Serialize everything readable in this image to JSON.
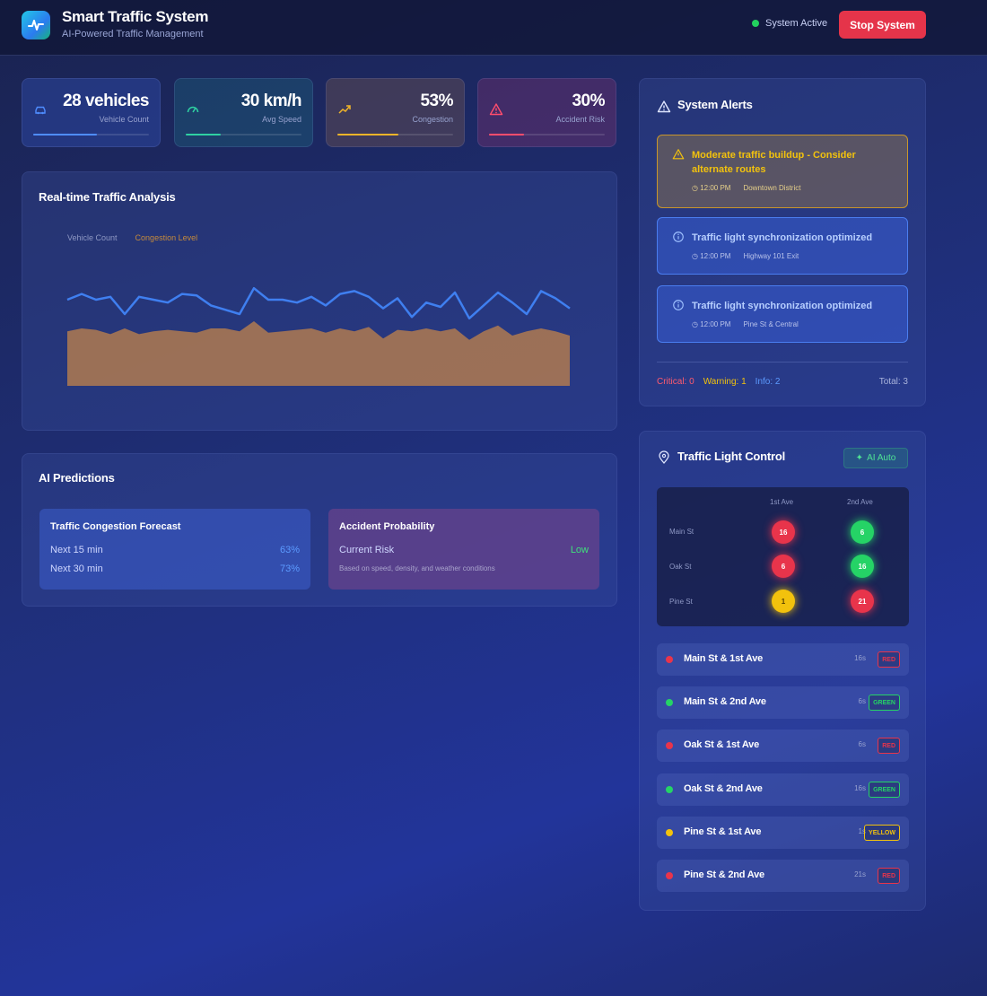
{
  "header": {
    "title": "Smart Traffic System",
    "subtitle": "AI-Powered Traffic Management",
    "status_text": "System Active",
    "stop_label": "Stop System"
  },
  "stats": [
    {
      "value": "28 vehicles",
      "label": "Vehicle Count",
      "icon": "car-icon",
      "color": "#4f8dff",
      "level": 0.55
    },
    {
      "value": "30 km/h",
      "label": "Avg Speed",
      "icon": "gauge-icon",
      "color": "#2fd1a2",
      "level": 0.3
    },
    {
      "value": "53%",
      "label": "Congestion",
      "icon": "trend-up-icon",
      "color": "#f0b429",
      "level": 0.53
    },
    {
      "value": "30%",
      "label": "Accident Risk",
      "icon": "warning-icon",
      "color": "#ff4d6d",
      "level": 0.3
    }
  ],
  "chart": {
    "title": "Real-time Traffic Analysis",
    "legend": [
      "Vehicle Count",
      "Congestion Level"
    ],
    "colors": {
      "vehicle": "#3f7ff0",
      "congestion": "#b07a50"
    }
  },
  "chart_data": {
    "type": "area",
    "title": "Real-time Traffic Analysis",
    "xlabel": "",
    "ylabel": "",
    "ylim": [
      0,
      100
    ],
    "grid": false,
    "legend": "top-left",
    "series": [
      {
        "name": "Vehicle Count",
        "type": "line",
        "values": [
          60,
          64,
          60,
          62,
          50,
          62,
          60,
          58,
          64,
          63,
          56,
          53,
          50,
          68,
          60,
          60,
          58,
          62,
          56,
          64,
          66,
          62,
          54,
          61,
          48,
          58,
          55,
          65,
          47,
          56,
          65,
          58,
          50,
          66,
          61,
          54
        ]
      },
      {
        "name": "Congestion Level",
        "type": "area",
        "values": [
          38,
          40,
          39,
          36,
          40,
          36,
          38,
          39,
          38,
          37,
          40,
          40,
          38,
          45,
          37,
          38,
          39,
          40,
          37,
          40,
          38,
          41,
          33,
          39,
          38,
          40,
          38,
          40,
          32,
          38,
          42,
          35,
          38,
          40,
          38,
          35
        ]
      }
    ]
  },
  "predictions": {
    "title": "AI Predictions",
    "congestion": {
      "title": "Traffic Congestion Forecast",
      "rows": [
        {
          "label": "Next 15 min",
          "value": "63%"
        },
        {
          "label": "Next 30 min",
          "value": "73%"
        }
      ]
    },
    "accident": {
      "title": "Accident Probability",
      "risk_label": "Current Risk",
      "risk_value": "Low",
      "note": "Based on speed, density, and weather conditions"
    }
  },
  "alerts": {
    "title": "System Alerts",
    "items": [
      {
        "level": "warning",
        "text": "Moderate traffic buildup - Consider alternate routes",
        "time": "12:00 PM",
        "location": "Downtown District"
      },
      {
        "level": "info",
        "text": "Traffic light synchronization optimized",
        "time": "12:00 PM",
        "location": "Highway 101 Exit"
      },
      {
        "level": "info",
        "text": "Traffic light synchronization optimized",
        "time": "12:00 PM",
        "location": "Pine St & Central"
      }
    ],
    "summary": {
      "critical": "Critical: 0",
      "warning": "Warning: 1",
      "info": "Info: 2",
      "total": "Total: 3"
    }
  },
  "lights": {
    "title": "Traffic Light Control",
    "ai_label": "AI Auto",
    "columns": [
      "1st Ave",
      "2nd Ave"
    ],
    "rows": [
      {
        "street": "Main St",
        "lights": [
          {
            "state": "red",
            "count": "16"
          },
          {
            "state": "green",
            "count": "6"
          }
        ]
      },
      {
        "street": "Oak St",
        "lights": [
          {
            "state": "red",
            "count": "6"
          },
          {
            "state": "green",
            "count": "16"
          }
        ]
      },
      {
        "street": "Pine St",
        "lights": [
          {
            "state": "yellow",
            "count": "1"
          },
          {
            "state": "red",
            "count": "21"
          }
        ]
      }
    ],
    "intersections": [
      {
        "name": "Main St & 1st Ave",
        "time": "16s",
        "state": "RED"
      },
      {
        "name": "Main St & 2nd Ave",
        "time": "6s",
        "state": "GREEN"
      },
      {
        "name": "Oak St & 1st Ave",
        "time": "6s",
        "state": "RED"
      },
      {
        "name": "Oak St & 2nd Ave",
        "time": "16s",
        "state": "GREEN"
      },
      {
        "name": "Pine St & 1st Ave",
        "time": "1s",
        "state": "YELLOW"
      },
      {
        "name": "Pine St & 2nd Ave",
        "time": "21s",
        "state": "RED"
      }
    ]
  },
  "state_colors": {
    "red": "#e8344b",
    "green": "#25d366",
    "yellow": "#f2c20d"
  }
}
